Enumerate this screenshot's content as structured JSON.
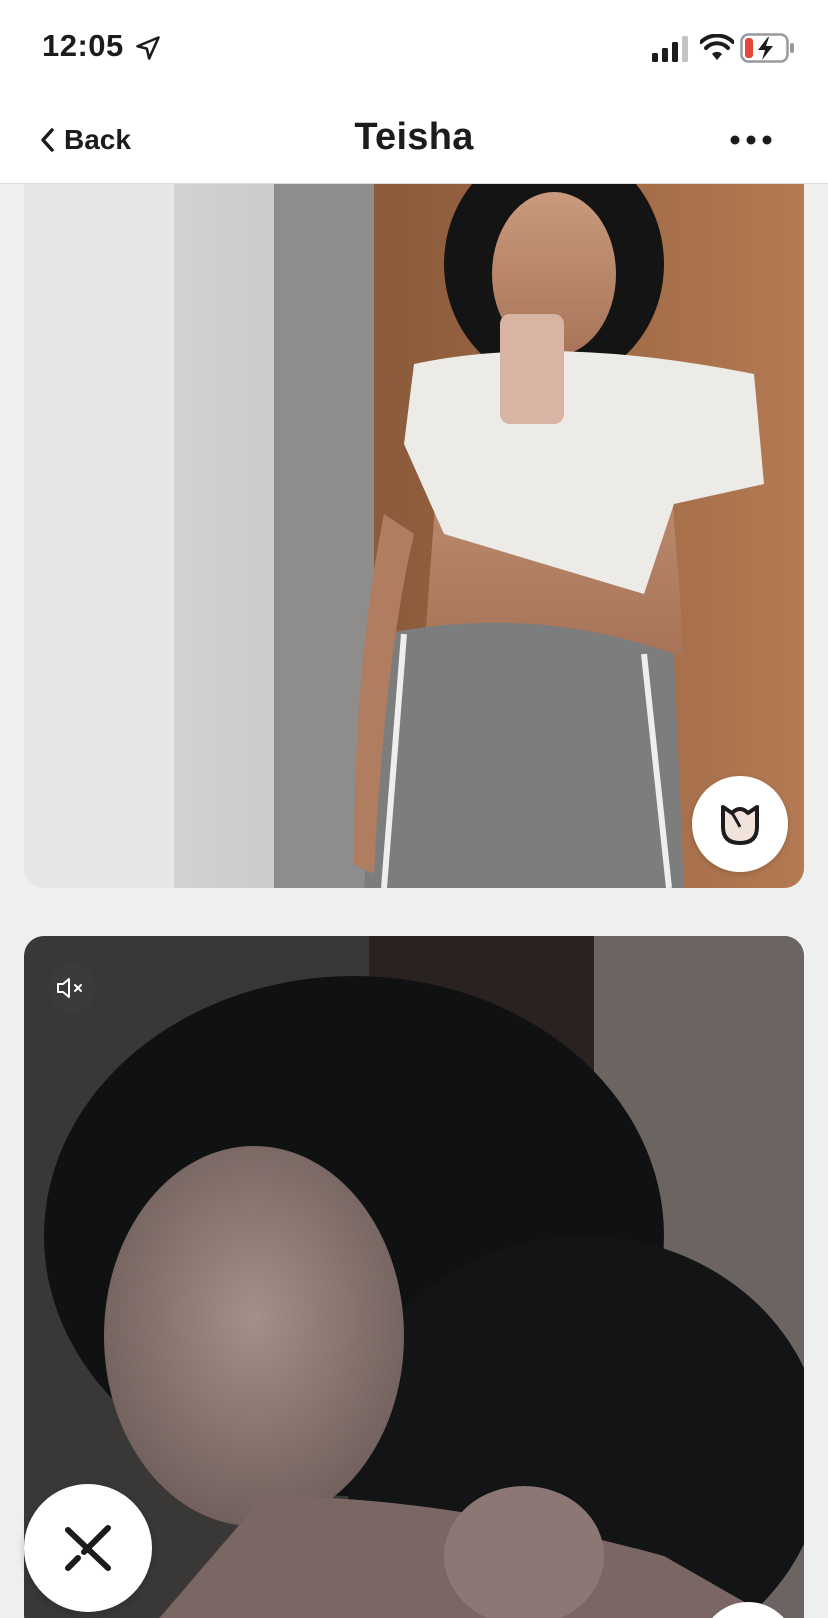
{
  "status_bar": {
    "time": "12:05",
    "icons": [
      "location-arrow-icon",
      "cellular-signal-icon",
      "wifi-icon",
      "battery-charging-icon"
    ],
    "battery_color": "#e5463c"
  },
  "nav": {
    "back_label": "Back",
    "title": "Teisha",
    "back_icon": "chevron-left-icon",
    "more_icon": "ellipsis-icon"
  },
  "photos": [
    {
      "kind": "photo",
      "action_icon": "rose-icon"
    },
    {
      "kind": "video",
      "overlay_icon": "mute-icon",
      "action_icon": "close-x-icon"
    }
  ],
  "colors": {
    "background": "#efeff0",
    "bar": "#ffffff",
    "text": "#1c1c1e"
  }
}
